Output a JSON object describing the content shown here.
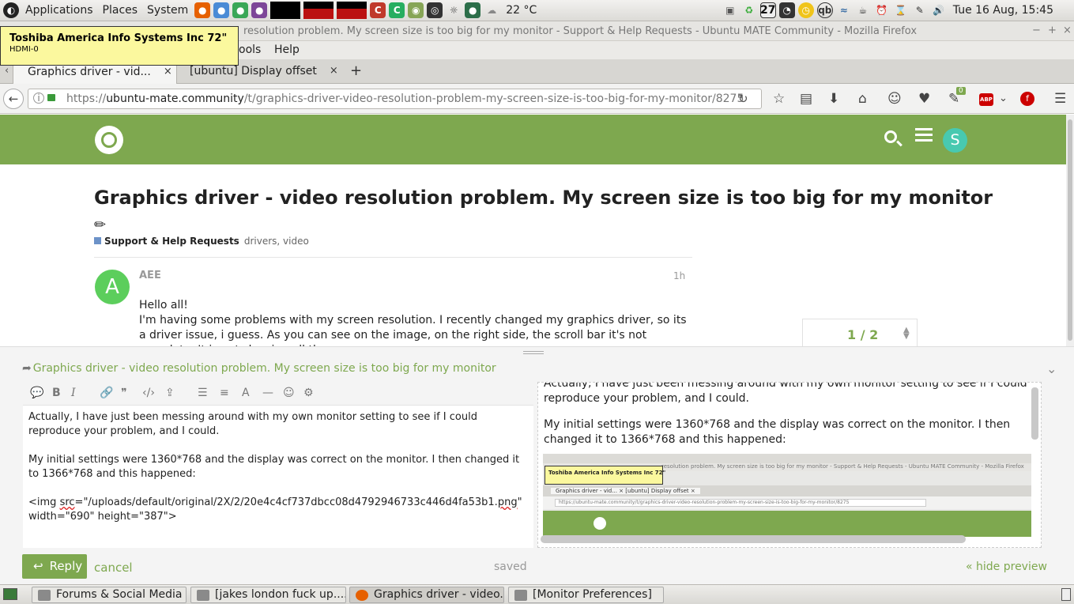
{
  "panel": {
    "menu": [
      "Applications",
      "Places",
      "System"
    ],
    "weather": "22 °C",
    "workspace_badge": "27",
    "clock": "Tue 16 Aug, 15:45",
    "app_letters": [
      "C",
      "C"
    ]
  },
  "tooltip": {
    "title": "Toshiba America Info Systems Inc 72\"",
    "subtitle": "HDMI-0"
  },
  "window": {
    "title": "resolution problem. My screen size is too big for my monitor - Support & Help Requests - Ubuntu MATE Community - Mozilla Firefox",
    "controls": [
      "−",
      "+",
      "×"
    ]
  },
  "menubar": {
    "items": [
      "ools",
      "Help"
    ]
  },
  "tabs": [
    {
      "label": "Graphics driver - vid...",
      "close": "×"
    },
    {
      "label": "[ubuntu] Display offset",
      "close": "×"
    }
  ],
  "new_tab": "+",
  "navbar": {
    "url_scheme": "https://",
    "url_host": "ubuntu-mate.community",
    "url_path": "/t/graphics-driver-video-resolution-problem-my-screen-size-is-too-big-for-my-monitor/8275",
    "pocket_badge": "0",
    "abp": "ABP"
  },
  "site": {
    "avatar_letter": "S"
  },
  "topic": {
    "title": "Graphics driver - video resolution problem. My screen size is too big for my monitor",
    "category": "Support & Help Requests",
    "tags": "drivers, video"
  },
  "post": {
    "avatar_letter": "A",
    "username": "AEE",
    "time": "1h",
    "line1": "Hello all!",
    "line2": "I'm having some problems with my screen resolution. I recently changed my graphics driver, so its a driver issue, i guess. As you can see on the image, on the right side, the scroll bar it's not complete. It is not showing all the page. ..."
  },
  "progress": {
    "label": "1 / 2"
  },
  "composer": {
    "reply_title": "Graphics driver - video resolution problem. My screen size is too big for my monitor",
    "editor_p1": "Actually, I have just been messing around with my own monitor setting to see if I could reproduce your problem, and I could.",
    "editor_p2": "My initial settings were 1360*768 and the display was correct on the monitor. I then changed it to 1366*768 and this happened:",
    "editor_img_a": "<img ",
    "editor_img_src": "src",
    "editor_img_b": "=\"/uploads/default/original/2X/2/20e4c4cf737dbcc08d4792946733c446d4fa53b1.",
    "editor_img_png": "png",
    "editor_img_c": "\"",
    "editor_img_d": "width=\"690\" height=\"387\">",
    "preview_p1": "Actually, I have just been messing around with my own monitor setting to see if I could reproduce your problem, and I could.",
    "preview_p2": "My initial settings were 1360*768 and the display was correct on the monitor. I then changed it to 1366*768 and this happened:",
    "thumb_title": "resolution problem. My screen size is too big for my monitor - Support & Help Requests - Ubuntu MATE Community - Mozilla Firefox",
    "thumb_tooltip": "Toshiba America Info Systems Inc 72\"",
    "thumb_tabs": "Graphics driver - vid...   ×   [ubuntu] Display offset   ×",
    "thumb_url": "https://ubuntu-mate.community/t/graphics-driver-video-resolution-problem-my-screen-size-is-too-big-for-my-monitor/8275",
    "reply_button": "Reply",
    "cancel": "cancel",
    "saved": "saved",
    "hide_preview": "« hide preview"
  },
  "taskbar": [
    {
      "label": "Forums & Social Media"
    },
    {
      "label": "[jakes london fuck up...."
    },
    {
      "label": "Graphics driver - video..."
    },
    {
      "label": "[Monitor Preferences]"
    }
  ]
}
